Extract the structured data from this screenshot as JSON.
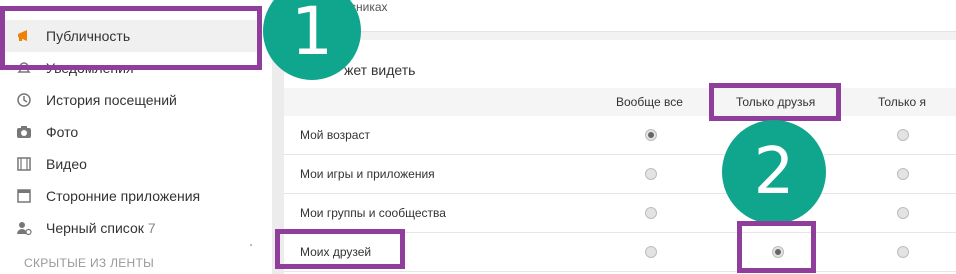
{
  "sidebar": {
    "items": [
      {
        "label": "Публичность",
        "icon": "megaphone-icon",
        "active": true
      },
      {
        "label": "Уведомления",
        "icon": "bell-icon"
      },
      {
        "label": "История посещений",
        "icon": "history-icon"
      },
      {
        "label": "Фото",
        "icon": "camera-icon"
      },
      {
        "label": "Видео",
        "icon": "film-icon"
      },
      {
        "label": "Сторонние приложения",
        "icon": "window-icon"
      },
      {
        "label": "Черный список",
        "icon": "user-blocked-icon",
        "count": "7"
      }
    ],
    "section": "СКРЫТЫЕ ИЗ ЛЕНТЫ"
  },
  "main": {
    "top_text": "ссниках",
    "section_title": "жет видеть",
    "columns": [
      "Вообще все",
      "Только друзья",
      "Только я"
    ],
    "rows": [
      {
        "label": "Мой возраст",
        "selected": 0
      },
      {
        "label": "Мои игры и приложения",
        "selected": 1
      },
      {
        "label": "Мои группы и сообщества",
        "selected": 1
      },
      {
        "label": "Моих друзей",
        "selected": 1
      }
    ]
  },
  "annotations": {
    "badge1": "1",
    "badge2": "2"
  },
  "colors": {
    "highlight": "#8f3f9b",
    "badge": "#10a58d",
    "accent": "#ee8208"
  }
}
